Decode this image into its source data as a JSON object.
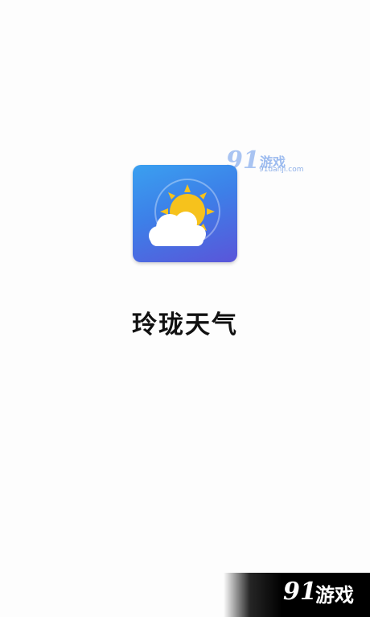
{
  "app": {
    "name": "玲珑天气",
    "icon": "weather-sun-cloud-icon"
  },
  "watermark_top": {
    "number": "91",
    "brand": "游戏",
    "site": "91danji.com"
  },
  "corner_badge": {
    "number": "91",
    "brand": "游戏"
  },
  "colors": {
    "icon_gradient_top": "#3aa0f0",
    "icon_gradient_bottom": "#5a55d9",
    "sun": "#f6c21c",
    "cloud": "#ffffff",
    "title": "#111111"
  }
}
